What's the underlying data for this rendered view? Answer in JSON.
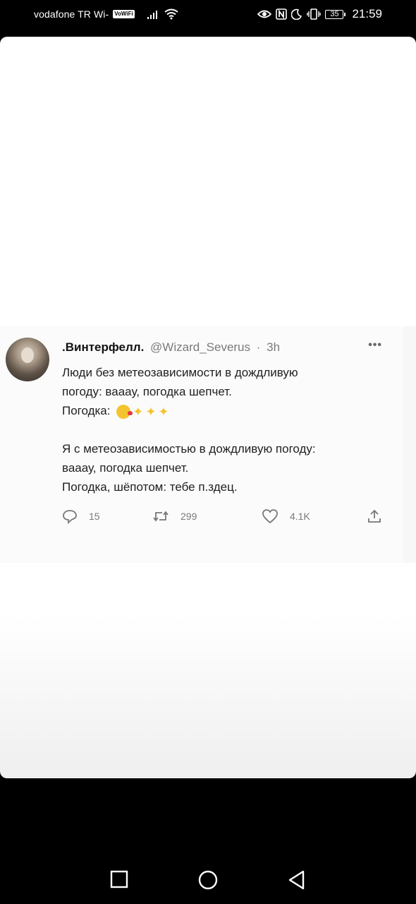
{
  "status_bar": {
    "carrier": "vodafone TR Wi-",
    "vowifi_badge": "VoWiFi",
    "battery_level": "35",
    "time": "21:59",
    "icons": [
      "signal-icon",
      "wifi-icon",
      "eye-icon",
      "nfc-icon",
      "do-not-disturb-icon",
      "vibrate-icon",
      "battery-icon"
    ]
  },
  "tweet": {
    "display_name": ".Винтерфелл.",
    "handle": "@Wizard_Severus",
    "separator": "·",
    "time_ago": "3h",
    "lines_part1": [
      "Люди без метеозависимости в дождливую",
      "погоду: вааау, погодка шепчет."
    ],
    "weather_label": "Погодка:",
    "emojis": [
      "kissing-face-emoji",
      "sparkles-emoji",
      "sparkles-emoji",
      "sparkles-emoji"
    ],
    "lines_part2": [
      "Я с метеозависимостью в дождливую погоду:",
      "вааау, погодка шепчет.",
      "Погодка, шёпотом: тебе п.здец."
    ],
    "replies": "15",
    "retweets": "299",
    "likes": "4.1K"
  },
  "nav_bar": {
    "buttons": [
      "recents-button",
      "home-button",
      "back-button"
    ]
  }
}
